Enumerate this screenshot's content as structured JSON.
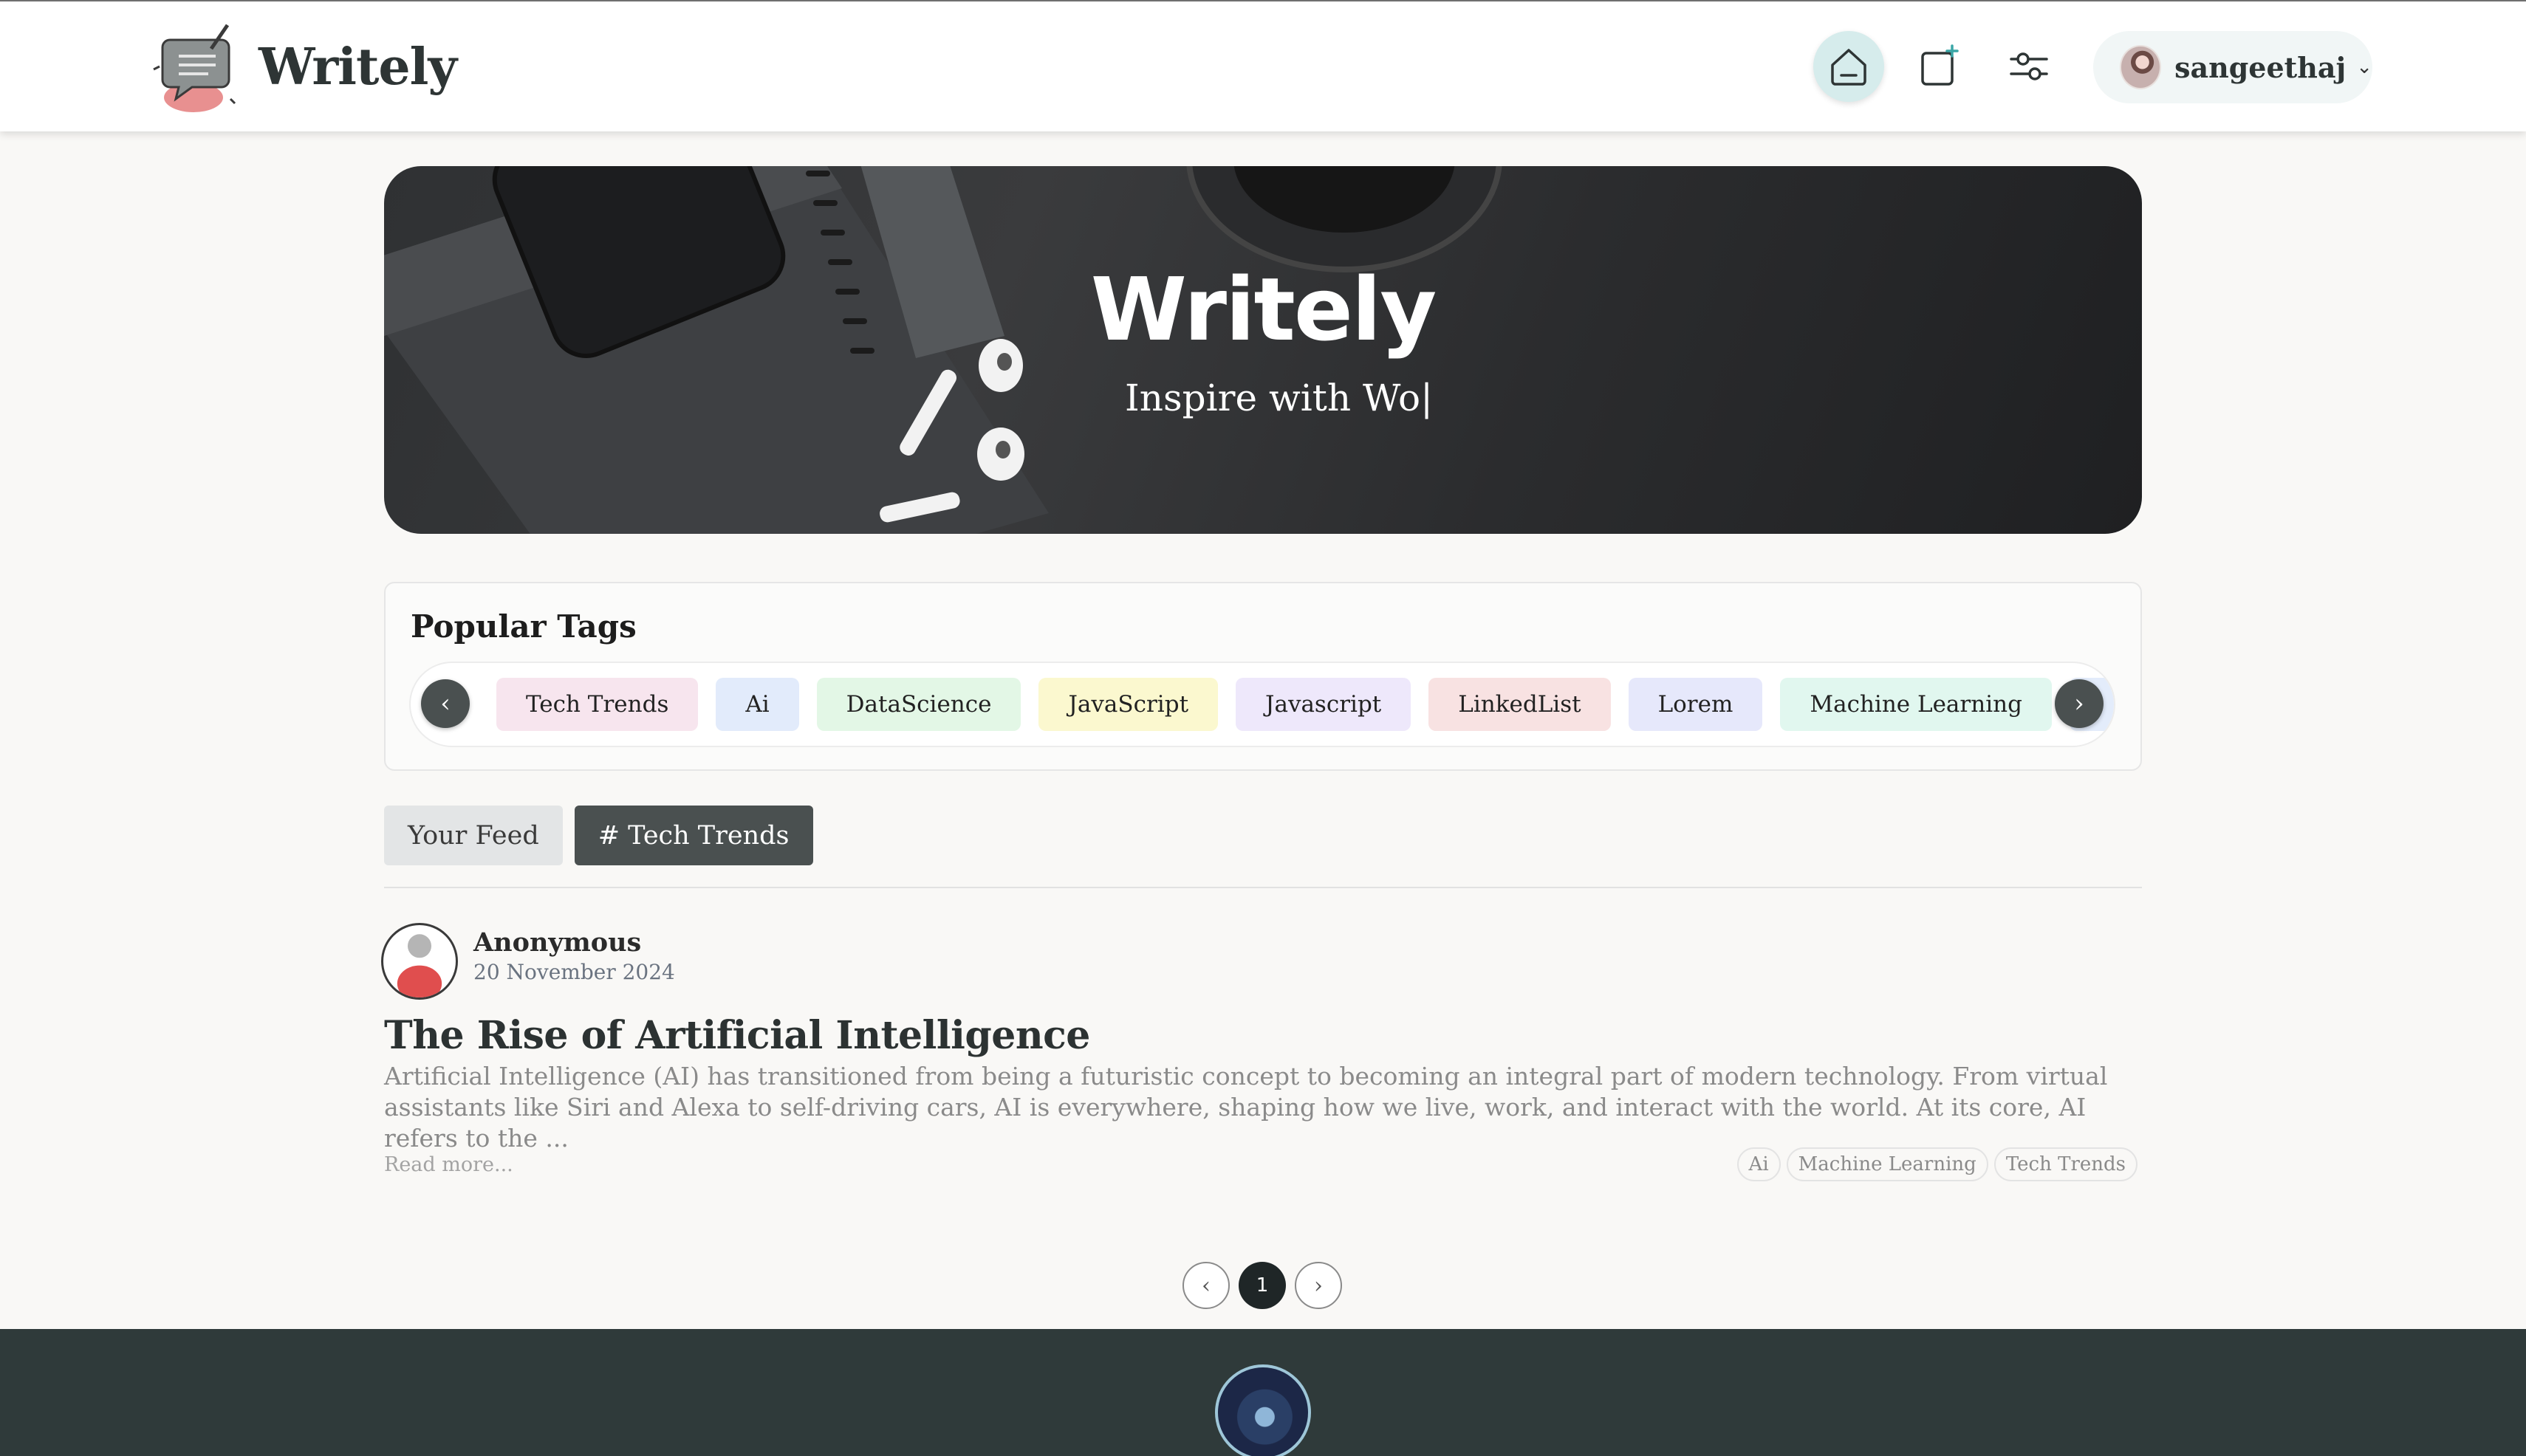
{
  "navbar": {
    "brand": "Writely",
    "icons": [
      "home-icon",
      "new-post-icon",
      "settings-sliders-icon"
    ],
    "user": {
      "name": "sangeethaj"
    },
    "colors": {
      "active_icon_bg": "#d6ecec",
      "user_chip_bg": "#f1f6f6"
    }
  },
  "hero": {
    "title": "Writely",
    "subtitle": "Inspire with Wo|"
  },
  "popular_tags": {
    "heading": "Popular Tags",
    "prev_glyph": "‹",
    "next_glyph": "›",
    "tags": [
      {
        "label": "Tech Trends",
        "color": "#f7e5ee"
      },
      {
        "label": "Ai",
        "color": "#e2ebfb"
      },
      {
        "label": "DataScience",
        "color": "#e3f7e6"
      },
      {
        "label": "JavaScript",
        "color": "#fbf8cf"
      },
      {
        "label": "Javascript",
        "color": "#eee8fb"
      },
      {
        "label": "LinkedList",
        "color": "#f8e2e2"
      },
      {
        "label": "Lorem",
        "color": "#e6e8fb"
      },
      {
        "label": "Machine Learning",
        "color": "#e1f7ef"
      },
      {
        "label": "",
        "color": "#e3ecfb"
      }
    ]
  },
  "feed_tabs": {
    "your_feed": "Your Feed",
    "active_tag": "# Tech Trends"
  },
  "post": {
    "author": "Anonymous",
    "date": "20 November 2024",
    "title": "The Rise of Artificial Intelligence",
    "excerpt": "Artificial Intelligence (AI) has transitioned from being a futuristic concept to becoming an integral part of modern technology. From virtual assistants like Siri and Alexa to self-driving cars, AI is everywhere, shaping how we live, work, and interact with the world. At its core, AI refers to the ...",
    "read_more": "Read more...",
    "tags": [
      "Ai",
      "Machine Learning",
      "Tech Trends"
    ]
  },
  "pagination": {
    "prev_glyph": "‹",
    "current_page": "1",
    "next_glyph": "›"
  },
  "footer": {
    "avatar": "footer-avatar-image"
  }
}
